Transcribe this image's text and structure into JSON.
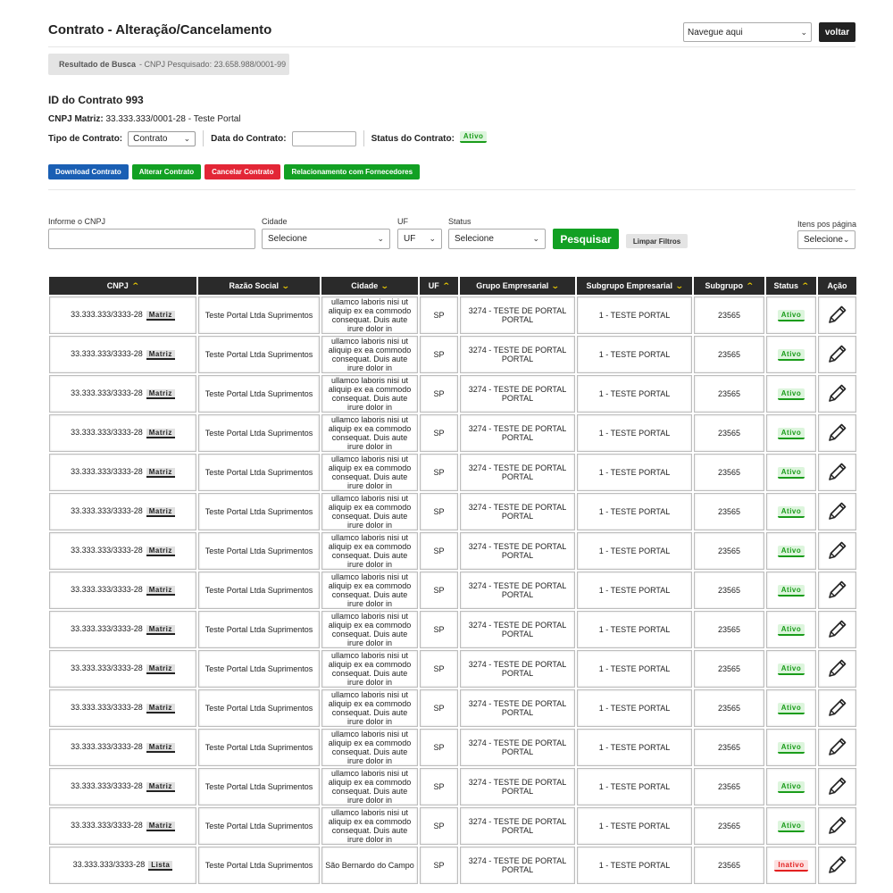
{
  "header": {
    "title": "Contrato - Alteração/Cancelamento",
    "nav_select": "Navegue aqui",
    "back_label": "voltar"
  },
  "search_result": {
    "label": "Resultado de Busca",
    "detail": "- CNPJ Pesquisado: 23.658.988/0001-99"
  },
  "contract": {
    "id_label": "ID do Contrato 993",
    "cnpj_label": "CNPJ Matriz:",
    "cnpj_value": "33.333.333/0001-28 - Teste Portal",
    "type_label": "Tipo de Contrato:",
    "type_value": "Contrato",
    "date_label": "Data do Contrato:",
    "date_value": "",
    "status_label": "Status do Contrato:",
    "status_value": "Ativo"
  },
  "actions": {
    "download": "Download Contrato",
    "alter": "Alterar Contrato",
    "cancel": "Cancelar Contrato",
    "suppliers": "Relacionamento com Fornecedores"
  },
  "filters": {
    "cnpj_label": "Informe o CNPJ",
    "cnpj_value": "",
    "city_label": "Cidade",
    "city_value": "Selecione",
    "uf_label": "UF",
    "uf_value": "UF",
    "status_label": "Status",
    "status_value": "Selecione",
    "search_button": "Pesquisar",
    "clear_button": "Limpar Filtros",
    "per_page_label": "Itens pos página",
    "per_page_value": "Selecione"
  },
  "table": {
    "columns": [
      "CNPJ",
      "Razão Social",
      "Cidade",
      "UF",
      "Grupo Empresarial",
      "Subgrupo Empresarial",
      "Subgrupo",
      "Status",
      "Ação"
    ],
    "rows": [
      {
        "cnpj": "33.333.333/3333-28",
        "tag": "Matriz",
        "razao": "Teste Portal Ltda Suprimentos",
        "cidade": "ullamco laboris nisi ut aliquip ex ea commodo consequat. Duis aute irure dolor in",
        "uf": "SP",
        "grupo": "3274 - TESTE DE PORTAL PORTAL",
        "subgrupo_emp": "1 - TESTE PORTAL",
        "subgrupo": "23565",
        "status": "Ativo"
      },
      {
        "cnpj": "33.333.333/3333-28",
        "tag": "Matriz",
        "razao": "Teste Portal Ltda Suprimentos",
        "cidade": "ullamco laboris nisi ut aliquip ex ea commodo consequat. Duis aute irure dolor in",
        "uf": "SP",
        "grupo": "3274 - TESTE DE PORTAL PORTAL",
        "subgrupo_emp": "1 - TESTE PORTAL",
        "subgrupo": "23565",
        "status": "Ativo"
      },
      {
        "cnpj": "33.333.333/3333-28",
        "tag": "Matriz",
        "razao": "Teste Portal Ltda Suprimentos",
        "cidade": "ullamco laboris nisi ut aliquip ex ea commodo consequat. Duis aute irure dolor in",
        "uf": "SP",
        "grupo": "3274 - TESTE DE PORTAL PORTAL",
        "subgrupo_emp": "1 - TESTE PORTAL",
        "subgrupo": "23565",
        "status": "Ativo"
      },
      {
        "cnpj": "33.333.333/3333-28",
        "tag": "Matriz",
        "razao": "Teste Portal Ltda Suprimentos",
        "cidade": "ullamco laboris nisi ut aliquip ex ea commodo consequat. Duis aute irure dolor in",
        "uf": "SP",
        "grupo": "3274 - TESTE DE PORTAL PORTAL",
        "subgrupo_emp": "1 - TESTE PORTAL",
        "subgrupo": "23565",
        "status": "Ativo"
      },
      {
        "cnpj": "33.333.333/3333-28",
        "tag": "Matriz",
        "razao": "Teste Portal Ltda Suprimentos",
        "cidade": "ullamco laboris nisi ut aliquip ex ea commodo consequat. Duis aute irure dolor in",
        "uf": "SP",
        "grupo": "3274 - TESTE DE PORTAL PORTAL",
        "subgrupo_emp": "1 - TESTE PORTAL",
        "subgrupo": "23565",
        "status": "Ativo"
      },
      {
        "cnpj": "33.333.333/3333-28",
        "tag": "Matriz",
        "razao": "Teste Portal Ltda Suprimentos",
        "cidade": "ullamco laboris nisi ut aliquip ex ea commodo consequat. Duis aute irure dolor in",
        "uf": "SP",
        "grupo": "3274 - TESTE DE PORTAL PORTAL",
        "subgrupo_emp": "1 - TESTE PORTAL",
        "subgrupo": "23565",
        "status": "Ativo"
      },
      {
        "cnpj": "33.333.333/3333-28",
        "tag": "Matriz",
        "razao": "Teste Portal Ltda Suprimentos",
        "cidade": "ullamco laboris nisi ut aliquip ex ea commodo consequat. Duis aute irure dolor in",
        "uf": "SP",
        "grupo": "3274 - TESTE DE PORTAL PORTAL",
        "subgrupo_emp": "1 - TESTE PORTAL",
        "subgrupo": "23565",
        "status": "Ativo"
      },
      {
        "cnpj": "33.333.333/3333-28",
        "tag": "Matriz",
        "razao": "Teste Portal Ltda Suprimentos",
        "cidade": "ullamco laboris nisi ut aliquip ex ea commodo consequat. Duis aute irure dolor in",
        "uf": "SP",
        "grupo": "3274 - TESTE DE PORTAL PORTAL",
        "subgrupo_emp": "1 - TESTE PORTAL",
        "subgrupo": "23565",
        "status": "Ativo"
      },
      {
        "cnpj": "33.333.333/3333-28",
        "tag": "Matriz",
        "razao": "Teste Portal Ltda Suprimentos",
        "cidade": "ullamco laboris nisi ut aliquip ex ea commodo consequat. Duis aute irure dolor in",
        "uf": "SP",
        "grupo": "3274 - TESTE DE PORTAL PORTAL",
        "subgrupo_emp": "1 - TESTE PORTAL",
        "subgrupo": "23565",
        "status": "Ativo"
      },
      {
        "cnpj": "33.333.333/3333-28",
        "tag": "Matriz",
        "razao": "Teste Portal Ltda Suprimentos",
        "cidade": "ullamco laboris nisi ut aliquip ex ea commodo consequat. Duis aute irure dolor in",
        "uf": "SP",
        "grupo": "3274 - TESTE DE PORTAL PORTAL",
        "subgrupo_emp": "1 - TESTE PORTAL",
        "subgrupo": "23565",
        "status": "Ativo"
      },
      {
        "cnpj": "33.333.333/3333-28",
        "tag": "Matriz",
        "razao": "Teste Portal Ltda Suprimentos",
        "cidade": "ullamco laboris nisi ut aliquip ex ea commodo consequat. Duis aute irure dolor in",
        "uf": "SP",
        "grupo": "3274 - TESTE DE PORTAL PORTAL",
        "subgrupo_emp": "1 - TESTE PORTAL",
        "subgrupo": "23565",
        "status": "Ativo"
      },
      {
        "cnpj": "33.333.333/3333-28",
        "tag": "Matriz",
        "razao": "Teste Portal Ltda Suprimentos",
        "cidade": "ullamco laboris nisi ut aliquip ex ea commodo consequat. Duis aute irure dolor in",
        "uf": "SP",
        "grupo": "3274 - TESTE DE PORTAL PORTAL",
        "subgrupo_emp": "1 - TESTE PORTAL",
        "subgrupo": "23565",
        "status": "Ativo"
      },
      {
        "cnpj": "33.333.333/3333-28",
        "tag": "Matriz",
        "razao": "Teste Portal Ltda Suprimentos",
        "cidade": "ullamco laboris nisi ut aliquip ex ea commodo consequat. Duis aute irure dolor in",
        "uf": "SP",
        "grupo": "3274 - TESTE DE PORTAL PORTAL",
        "subgrupo_emp": "1 - TESTE PORTAL",
        "subgrupo": "23565",
        "status": "Ativo"
      },
      {
        "cnpj": "33.333.333/3333-28",
        "tag": "Matriz",
        "razao": "Teste Portal Ltda Suprimentos",
        "cidade": "ullamco laboris nisi ut aliquip ex ea commodo consequat. Duis aute irure dolor in",
        "uf": "SP",
        "grupo": "3274 - TESTE DE PORTAL PORTAL",
        "subgrupo_emp": "1 - TESTE PORTAL",
        "subgrupo": "23565",
        "status": "Ativo"
      },
      {
        "cnpj": "33.333.333/3333-28",
        "tag": "Lista",
        "razao": "Teste Portal Ltda Suprimentos",
        "cidade": "São Bernardo do Campo",
        "uf": "SP",
        "grupo": "3274 - TESTE DE PORTAL PORTAL",
        "subgrupo_emp": "1 - TESTE PORTAL",
        "subgrupo": "23565",
        "status": "Inativo"
      }
    ]
  },
  "colors": {
    "header_dark": "#2a2a2a",
    "sort_arrow": "#f3d100",
    "primary_green": "#12a023",
    "primary_blue": "#1a5fb4",
    "danger_red": "#e32636"
  },
  "icons": {
    "sort": "sort-arrow-icon",
    "edit": "pencil-icon",
    "dropdown": "chevron-down-icon"
  }
}
